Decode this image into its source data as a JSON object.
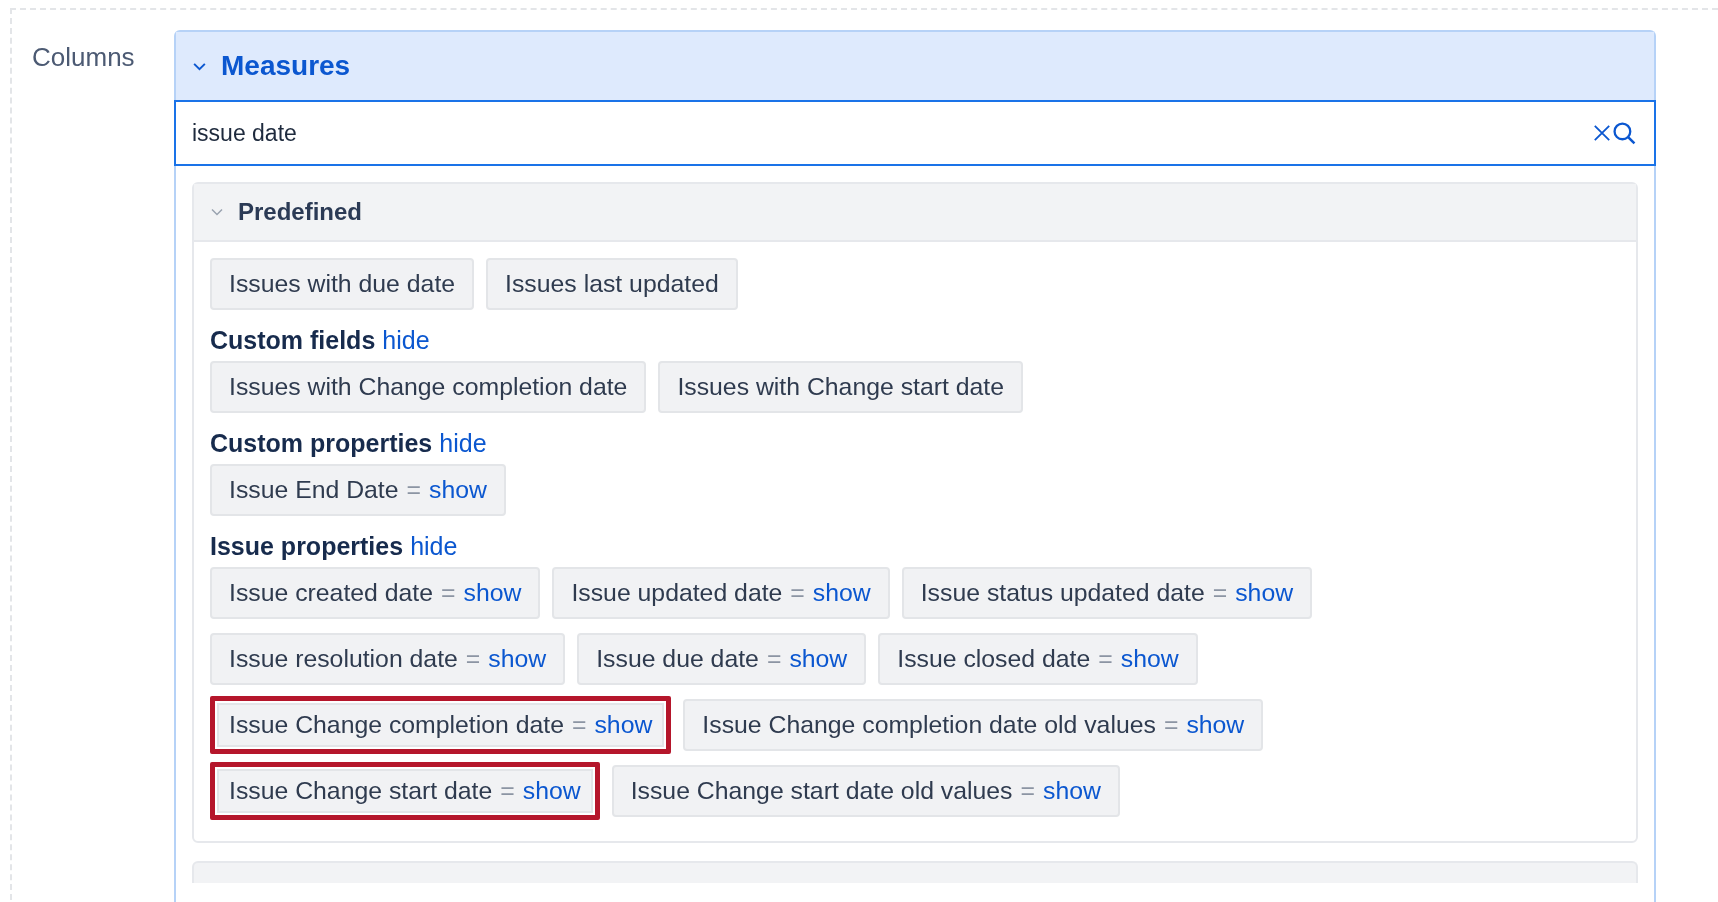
{
  "label": "Columns",
  "panel": {
    "title": "Measures",
    "expanded": true,
    "search": {
      "value": "issue date"
    },
    "groups": [
      {
        "title": "Predefined",
        "expanded": true,
        "sections": [
          {
            "items": [
              {
                "label": "Issues with due date",
                "highlighted": false
              },
              {
                "label": "Issues last updated",
                "highlighted": false
              }
            ]
          },
          {
            "heading": "Custom fields",
            "toggle": "hide",
            "items": [
              {
                "label": "Issues with Change completion date",
                "highlighted": false
              },
              {
                "label": "Issues with Change start date",
                "highlighted": false
              }
            ]
          },
          {
            "heading": "Custom properties",
            "toggle": "hide",
            "items": [
              {
                "label": "Issue End Date",
                "eq": "=",
                "action": "show",
                "highlighted": false
              }
            ]
          },
          {
            "heading": "Issue properties",
            "toggle": "hide",
            "items": [
              {
                "label": "Issue created date",
                "eq": "=",
                "action": "show",
                "highlighted": false
              },
              {
                "label": "Issue updated date",
                "eq": "=",
                "action": "show",
                "highlighted": false
              },
              {
                "label": "Issue status updated date",
                "eq": "=",
                "action": "show",
                "highlighted": false
              },
              {
                "label": "Issue resolution date",
                "eq": "=",
                "action": "show",
                "highlighted": false
              },
              {
                "label": "Issue due date",
                "eq": "=",
                "action": "show",
                "highlighted": false
              },
              {
                "label": "Issue closed date",
                "eq": "=",
                "action": "show",
                "highlighted": false
              },
              {
                "label": "Issue Change completion date",
                "eq": "=",
                "action": "show",
                "highlighted": true
              },
              {
                "label": "Issue Change completion date old values",
                "eq": "=",
                "action": "show",
                "highlighted": false
              },
              {
                "label": "Issue Change start date",
                "eq": "=",
                "action": "show",
                "highlighted": true
              },
              {
                "label": "Issue Change start date old values",
                "eq": "=",
                "action": "show",
                "highlighted": false
              }
            ]
          }
        ]
      }
    ]
  }
}
